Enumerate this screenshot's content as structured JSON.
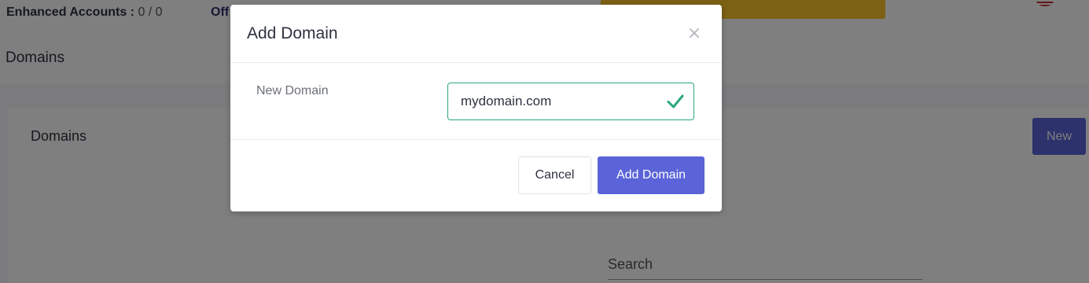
{
  "topbar": {
    "enhanced_label": "Enhanced Accounts :",
    "enhanced_value": "0 / 0",
    "offers_label": "Off"
  },
  "page": {
    "title": "Domains"
  },
  "card": {
    "title": "Domains",
    "new_label": "New",
    "search_placeholder": "Search"
  },
  "modal": {
    "title": "Add Domain",
    "close_glyph": "×",
    "field_label": "New Domain",
    "field_value": "mydomain.com",
    "cancel_label": "Cancel",
    "submit_label": "Add Domain"
  },
  "colors": {
    "primary": "#5a63d8",
    "success": "#28a77a",
    "warning": "#f8c22b"
  },
  "icons": {
    "close": "close-icon",
    "valid": "check-icon",
    "flag": "us-flag-icon"
  }
}
